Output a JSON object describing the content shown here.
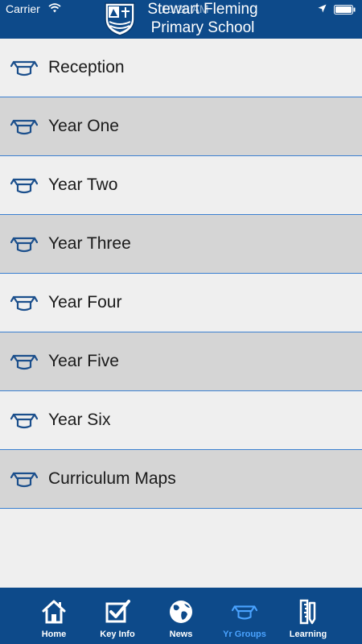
{
  "status_bar": {
    "carrier": "Carrier",
    "time": "10:28 AM",
    "icons": [
      "wifi-icon",
      "location-arrow-icon",
      "battery-icon"
    ]
  },
  "header": {
    "title_line1": "Stewart Fleming",
    "title_line2": "Primary School",
    "logo_icon": "school-crest-icon"
  },
  "list": {
    "item_icon": "graduation-cap-icon",
    "items": [
      {
        "label": "Reception"
      },
      {
        "label": "Year One"
      },
      {
        "label": "Year Two"
      },
      {
        "label": "Year Three"
      },
      {
        "label": "Year Four"
      },
      {
        "label": "Year Five"
      },
      {
        "label": "Year Six"
      },
      {
        "label": "Curriculum Maps"
      }
    ]
  },
  "tabbar": {
    "active_tab": "Yr Groups",
    "tabs": [
      {
        "label": "Home",
        "icon": "house-icon"
      },
      {
        "label": "Key Info",
        "icon": "checkbox-icon"
      },
      {
        "label": "News",
        "icon": "globe-icon"
      },
      {
        "label": "Yr Groups",
        "icon": "graduation-cap-icon"
      },
      {
        "label": "Learning",
        "icon": "ruler-pencil-icon"
      }
    ]
  },
  "colors": {
    "brand_blue": "#0d4a8a",
    "divider": "#3a7fd0",
    "active_tab": "#4aa3ff",
    "row_light": "#efefef",
    "row_dark": "#d5d5d5",
    "icon_blue": "#1b4f8c"
  }
}
